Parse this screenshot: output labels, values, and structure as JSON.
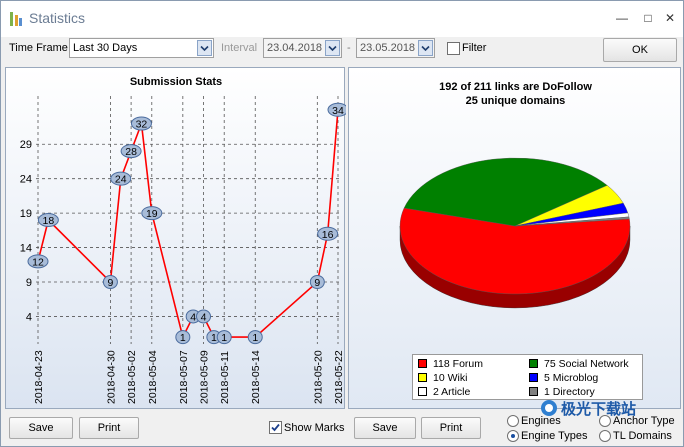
{
  "window": {
    "title": "Statistics"
  },
  "toolbar": {
    "timeframe_label": "Time Frame",
    "timeframe_value": "Last 30 Days",
    "interval_label": "Interval",
    "date_from": "23.04.2018",
    "date_sep": "-",
    "date_to": "23.05.2018",
    "filter_label": "Filter",
    "ok_label": "OK"
  },
  "chart_data": [
    {
      "type": "line",
      "title": "Submission Stats",
      "x": [
        "2018-04-23",
        "2018-04-24",
        "2018-04-30",
        "2018-05-01",
        "2018-05-02",
        "2018-05-03",
        "2018-05-04",
        "2018-05-07",
        "2018-05-08",
        "2018-05-09",
        "2018-05-10",
        "2018-05-11",
        "2018-05-14",
        "2018-05-20",
        "2018-05-21",
        "2018-05-22"
      ],
      "values": [
        12,
        18,
        9,
        24,
        28,
        32,
        19,
        1,
        4,
        4,
        1,
        1,
        1,
        9,
        16,
        34
      ],
      "x_tick_labels": [
        "2018-04-23",
        "2018-04-30",
        "2018-05-02",
        "2018-05-04",
        "2018-05-07",
        "2018-05-09",
        "2018-05-11",
        "2018-05-14",
        "2018-05-20",
        "2018-05-22"
      ],
      "y_ticks": [
        4,
        9,
        14,
        19,
        24,
        29
      ],
      "ylim": [
        0,
        36
      ],
      "grid": true,
      "color": "#ff0000"
    },
    {
      "type": "pie",
      "title": "192 of 211 links are DoFollow",
      "subtitle": "25 unique domains",
      "slices": [
        {
          "label": "118 Forum",
          "value": 118,
          "color": "#ff0000"
        },
        {
          "label": "75 Social Network",
          "value": 75,
          "color": "#008000"
        },
        {
          "label": "10 Wiki",
          "value": 10,
          "color": "#ffff00"
        },
        {
          "label": "5 Microblog",
          "value": 5,
          "color": "#0000ff"
        },
        {
          "label": "2 Article",
          "value": 2,
          "color": "#ffffff"
        },
        {
          "label": "1 Directory",
          "value": 1,
          "color": "#808080"
        }
      ]
    }
  ],
  "left_bottom": {
    "save_label": "Save",
    "print_label": "Print",
    "show_marks_label": "Show Marks"
  },
  "right_bottom": {
    "save_label": "Save",
    "print_label": "Print",
    "radio_engines": "Engines",
    "radio_anchor_type": "Anchor Type",
    "radio_engine_types": "Engine Types",
    "radio_tl_domains": "TL Domains"
  },
  "watermark_text": "极光下载站"
}
